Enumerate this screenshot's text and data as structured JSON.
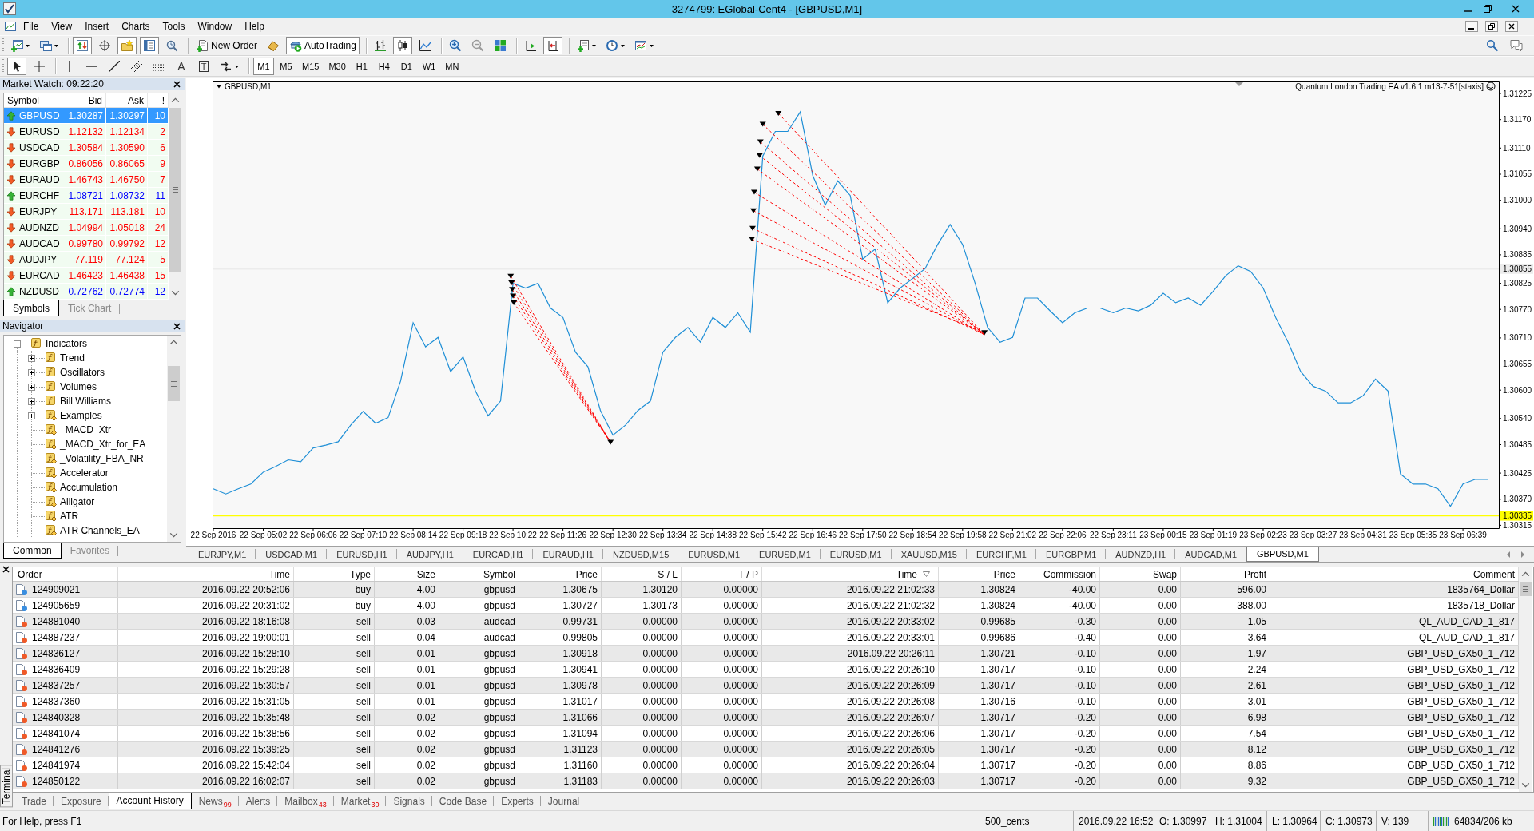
{
  "window": {
    "title": "3274799: EGlobal-Cent4 - [GBPUSD,M1]"
  },
  "menu": [
    "File",
    "View",
    "Insert",
    "Charts",
    "Tools",
    "Window",
    "Help"
  ],
  "toolbar": {
    "groups": [
      [
        {
          "pressed": false
        },
        {
          "pressed": false
        }
      ],
      [
        {
          "pressed": true
        },
        {
          "pressed": false
        },
        {
          "pressed": true
        },
        {
          "pressed": true
        },
        {
          "pressed": false
        }
      ],
      [
        {
          "label": "New Order",
          "pressed": false
        },
        {
          "pressed": false
        },
        {
          "label": "AutoTrading",
          "pressed": true
        }
      ],
      [
        {
          "pressed": false
        },
        {
          "pressed": true
        },
        {
          "pressed": false
        }
      ],
      [
        {
          "pressed": false
        },
        {
          "pressed": false
        },
        {
          "pressed": false
        }
      ],
      [
        {
          "pressed": false
        },
        {
          "pressed": true
        }
      ],
      [
        {
          "pressed": false
        },
        {
          "pressed": false
        },
        {
          "pressed": false
        }
      ]
    ]
  },
  "drawing_toolbar": {
    "groups": [
      [
        {
          "pressed": true
        },
        {
          "pressed": false
        }
      ],
      [
        {
          "pressed": false
        },
        {
          "pressed": false
        },
        {
          "pressed": false
        },
        {
          "pressed": false
        },
        {
          "pressed": false
        },
        {
          "glyph": "A",
          "pressed": false
        },
        {
          "glyph": "T",
          "pressed": false
        },
        {
          "pressed": false
        }
      ]
    ]
  },
  "timeframes": [
    {
      "label": "M1",
      "selected": true
    },
    {
      "label": "M5",
      "selected": false
    },
    {
      "label": "M15",
      "selected": false
    },
    {
      "label": "M30",
      "selected": false
    },
    {
      "label": "H1",
      "selected": false
    },
    {
      "label": "H4",
      "selected": false
    },
    {
      "label": "D1",
      "selected": false
    },
    {
      "label": "W1",
      "selected": false
    },
    {
      "label": "MN",
      "selected": false
    }
  ],
  "market_watch": {
    "title": "Market Watch: 09:22:20",
    "columns": [
      "Symbol",
      "Bid",
      "Ask",
      "!"
    ],
    "rows": [
      {
        "symbol": "GBPUSD",
        "bid": "1.30287",
        "ask": "1.30297",
        "spread": "10",
        "up": true,
        "selected": true
      },
      {
        "symbol": "EURUSD",
        "bid": "1.12132",
        "ask": "1.12134",
        "spread": "2",
        "up": false,
        "selected": false
      },
      {
        "symbol": "USDCAD",
        "bid": "1.30584",
        "ask": "1.30590",
        "spread": "6",
        "up": false,
        "selected": false
      },
      {
        "symbol": "EURGBP",
        "bid": "0.86056",
        "ask": "0.86065",
        "spread": "9",
        "up": false,
        "selected": false
      },
      {
        "symbol": "EURAUD",
        "bid": "1.46743",
        "ask": "1.46750",
        "spread": "7",
        "up": false,
        "selected": false
      },
      {
        "symbol": "EURCHF",
        "bid": "1.08721",
        "ask": "1.08732",
        "spread": "11",
        "up": true,
        "selected": false
      },
      {
        "symbol": "EURJPY",
        "bid": "113.171",
        "ask": "113.181",
        "spread": "10",
        "up": false,
        "selected": false
      },
      {
        "symbol": "AUDNZD",
        "bid": "1.04994",
        "ask": "1.05018",
        "spread": "24",
        "up": false,
        "selected": false
      },
      {
        "symbol": "AUDCAD",
        "bid": "0.99780",
        "ask": "0.99792",
        "spread": "12",
        "up": false,
        "selected": false
      },
      {
        "symbol": "AUDJPY",
        "bid": "77.119",
        "ask": "77.124",
        "spread": "5",
        "up": false,
        "selected": false
      },
      {
        "symbol": "EURCAD",
        "bid": "1.46423",
        "ask": "1.46438",
        "spread": "15",
        "up": false,
        "selected": false
      },
      {
        "symbol": "NZDUSD",
        "bid": "0.72762",
        "ask": "0.72774",
        "spread": "12",
        "up": true,
        "selected": false
      }
    ],
    "tabs": [
      {
        "label": "Symbols",
        "selected": true
      },
      {
        "label": "Tick Chart",
        "selected": false
      }
    ]
  },
  "navigator": {
    "title": "Navigator",
    "tree": [
      {
        "label": "Indicators",
        "kind": "folder",
        "custom": false,
        "expanded": true,
        "children": [
          {
            "label": "Trend",
            "kind": "folder",
            "custom": false,
            "expanded": false
          },
          {
            "label": "Oscillators",
            "kind": "folder",
            "custom": false,
            "expanded": false
          },
          {
            "label": "Volumes",
            "kind": "folder",
            "custom": false,
            "expanded": false
          },
          {
            "label": "Bill Williams",
            "kind": "folder",
            "custom": false,
            "expanded": false
          },
          {
            "label": "Examples",
            "kind": "folder",
            "custom": true,
            "expanded": false
          },
          {
            "label": "_MACD_Xtr",
            "kind": "item",
            "custom": true
          },
          {
            "label": "_MACD_Xtr_for_EA",
            "kind": "item",
            "custom": true
          },
          {
            "label": "_Volatility_FBA_NR",
            "kind": "item",
            "custom": true
          },
          {
            "label": "Accelerator",
            "kind": "item",
            "custom": true
          },
          {
            "label": "Accumulation",
            "kind": "item",
            "custom": true
          },
          {
            "label": "Alligator",
            "kind": "item",
            "custom": true
          },
          {
            "label": "ATR",
            "kind": "item",
            "custom": true
          },
          {
            "label": "ATR Channels_EA",
            "kind": "item",
            "custom": true
          }
        ]
      }
    ],
    "tabs": [
      {
        "label": "Common",
        "selected": true
      },
      {
        "label": "Favorites",
        "selected": false
      }
    ]
  },
  "chart": {
    "symbol": "GBPUSD,M1",
    "expert": "Quantum London Trading EA v1.6.1 m13-7-51[staxis]",
    "chart_data": {
      "type": "line",
      "xlim": [
        "2016-09-22T03:57",
        "2016-09-23T07:25"
      ],
      "ylim": [
        1.30309,
        1.31252
      ],
      "xticks": [
        {
          "value": "2016-09-22T03:58",
          "label": "22 Sep 2016"
        },
        {
          "value": "2016-09-22T05:02",
          "label": "22 Sep 05:02"
        },
        {
          "value": "2016-09-22T06:06",
          "label": "22 Sep 06:06"
        },
        {
          "value": "2016-09-22T07:10",
          "label": "22 Sep 07:10"
        },
        {
          "value": "2016-09-22T08:14",
          "label": "22 Sep 08:14"
        },
        {
          "value": "2016-09-22T09:18",
          "label": "22 Sep 09:18"
        },
        {
          "value": "2016-09-22T10:22",
          "label": "22 Sep 10:22"
        },
        {
          "value": "2016-09-22T11:26",
          "label": "22 Sep 11:26"
        },
        {
          "value": "2016-09-22T12:30",
          "label": "22 Sep 12:30"
        },
        {
          "value": "2016-09-22T13:34",
          "label": "22 Sep 13:34"
        },
        {
          "value": "2016-09-22T14:38",
          "label": "22 Sep 14:38"
        },
        {
          "value": "2016-09-22T15:42",
          "label": "22 Sep 15:42"
        },
        {
          "value": "2016-09-22T16:46",
          "label": "22 Sep 16:46"
        },
        {
          "value": "2016-09-22T17:50",
          "label": "22 Sep 17:50"
        },
        {
          "value": "2016-09-22T18:54",
          "label": "22 Sep 18:54"
        },
        {
          "value": "2016-09-22T19:58",
          "label": "22 Sep 19:58"
        },
        {
          "value": "2016-09-22T21:02",
          "label": "22 Sep 21:02"
        },
        {
          "value": "2016-09-22T22:06",
          "label": "22 Sep 22:06"
        },
        {
          "value": "2016-09-22T23:11",
          "label": "22 Sep 23:11"
        },
        {
          "value": "2016-09-23T00:15",
          "label": "23 Sep 00:15"
        },
        {
          "value": "2016-09-23T01:19",
          "label": "23 Sep 01:19"
        },
        {
          "value": "2016-09-23T02:23",
          "label": "23 Sep 02:23"
        },
        {
          "value": "2016-09-23T03:27",
          "label": "23 Sep 03:27"
        },
        {
          "value": "2016-09-23T04:31",
          "label": "23 Sep 04:31"
        },
        {
          "value": "2016-09-23T05:35",
          "label": "23 Sep 05:35"
        },
        {
          "value": "2016-09-23T06:39",
          "label": "23 Sep 06:39"
        }
      ],
      "yticks": [
        {
          "value": 1.31225,
          "label": "1.31225"
        },
        {
          "value": 1.3117,
          "label": "1.31170"
        },
        {
          "value": 1.3111,
          "label": "1.31110"
        },
        {
          "value": 1.31055,
          "label": "1.31055"
        },
        {
          "value": 1.31,
          "label": "1.31000"
        },
        {
          "value": 1.3094,
          "label": "1.30940"
        },
        {
          "value": 1.30885,
          "label": "1.30885"
        },
        {
          "value": 1.30825,
          "label": "1.30825"
        },
        {
          "value": 1.3077,
          "label": "1.30770"
        },
        {
          "value": 1.3071,
          "label": "1.30710"
        },
        {
          "value": 1.30655,
          "label": "1.30655"
        },
        {
          "value": 1.306,
          "label": "1.30600"
        },
        {
          "value": 1.3054,
          "label": "1.30540"
        },
        {
          "value": 1.30485,
          "label": "1.30485"
        },
        {
          "value": 1.30425,
          "label": "1.30425"
        },
        {
          "value": 1.3037,
          "label": "1.30370"
        },
        {
          "value": 1.30315,
          "label": "1.30315"
        }
      ],
      "ref_lines": [
        {
          "axis": "y",
          "value": 1.30855,
          "label": "1.30855",
          "color": "#ececec"
        },
        {
          "axis": "y",
          "value": 1.30335,
          "label": "1.30335",
          "color": "#ffff00"
        }
      ],
      "series": [
        {
          "color": "#1f8fd6",
          "x": [
            "2016-09-22T03:58",
            "2016-09-22T04:14",
            "2016-09-22T04:30",
            "2016-09-22T04:46",
            "2016-09-22T05:02",
            "2016-09-22T05:18",
            "2016-09-22T05:34",
            "2016-09-22T05:50",
            "2016-09-22T06:06",
            "2016-09-22T06:22",
            "2016-09-22T06:38",
            "2016-09-22T06:54",
            "2016-09-22T07:10",
            "2016-09-22T07:26",
            "2016-09-22T07:42",
            "2016-09-22T07:58",
            "2016-09-22T08:14",
            "2016-09-22T08:30",
            "2016-09-22T08:46",
            "2016-09-22T09:02",
            "2016-09-22T09:18",
            "2016-09-22T09:34",
            "2016-09-22T09:50",
            "2016-09-22T10:06",
            "2016-09-22T10:22",
            "2016-09-22T10:38",
            "2016-09-22T10:54",
            "2016-09-22T11:10",
            "2016-09-22T11:26",
            "2016-09-22T11:42",
            "2016-09-22T11:58",
            "2016-09-22T12:14",
            "2016-09-22T12:30",
            "2016-09-22T12:46",
            "2016-09-22T13:02",
            "2016-09-22T13:18",
            "2016-09-22T13:34",
            "2016-09-22T13:50",
            "2016-09-22T14:06",
            "2016-09-22T14:22",
            "2016-09-22T14:38",
            "2016-09-22T14:54",
            "2016-09-22T15:10",
            "2016-09-22T15:26",
            "2016-09-22T15:42",
            "2016-09-22T15:58",
            "2016-09-22T16:14",
            "2016-09-22T16:30",
            "2016-09-22T16:46",
            "2016-09-22T17:02",
            "2016-09-22T17:18",
            "2016-09-22T17:34",
            "2016-09-22T17:50",
            "2016-09-22T18:06",
            "2016-09-22T18:22",
            "2016-09-22T18:38",
            "2016-09-22T18:54",
            "2016-09-22T19:10",
            "2016-09-22T19:26",
            "2016-09-22T19:42",
            "2016-09-22T19:58",
            "2016-09-22T20:14",
            "2016-09-22T20:30",
            "2016-09-22T20:46",
            "2016-09-22T21:02",
            "2016-09-22T21:18",
            "2016-09-22T21:34",
            "2016-09-22T21:50",
            "2016-09-22T22:06",
            "2016-09-22T22:22",
            "2016-09-22T22:38",
            "2016-09-22T22:54",
            "2016-09-22T23:11",
            "2016-09-22T23:27",
            "2016-09-22T23:43",
            "2016-09-22T23:59",
            "2016-09-23T00:15",
            "2016-09-23T00:31",
            "2016-09-23T00:47",
            "2016-09-23T01:03",
            "2016-09-23T01:19",
            "2016-09-23T01:35",
            "2016-09-23T01:51",
            "2016-09-23T02:07",
            "2016-09-23T02:23",
            "2016-09-23T02:39",
            "2016-09-23T02:55",
            "2016-09-23T03:11",
            "2016-09-23T03:27",
            "2016-09-23T03:43",
            "2016-09-23T03:59",
            "2016-09-23T04:15",
            "2016-09-23T04:31",
            "2016-09-23T04:47",
            "2016-09-23T05:03",
            "2016-09-23T05:19",
            "2016-09-23T05:35",
            "2016-09-23T05:51",
            "2016-09-23T06:07",
            "2016-09-23T06:23",
            "2016-09-23T06:39",
            "2016-09-23T06:55",
            "2016-09-23T07:11"
          ],
          "values": [
            1.30392,
            1.30381,
            1.30392,
            1.30402,
            1.30427,
            1.30439,
            1.30453,
            1.30449,
            1.30478,
            1.30484,
            1.30491,
            1.30526,
            1.30555,
            1.3053,
            1.30542,
            1.30619,
            1.30742,
            1.30691,
            1.30711,
            1.30639,
            1.3067,
            1.30598,
            1.30546,
            1.30577,
            1.30825,
            1.30815,
            1.30825,
            1.30773,
            1.30753,
            1.3068,
            1.30649,
            1.30557,
            1.30505,
            1.30526,
            1.30557,
            1.30577,
            1.3068,
            1.30711,
            1.30732,
            1.30701,
            1.30753,
            1.30732,
            1.30763,
            1.30722,
            1.31093,
            1.31145,
            1.31145,
            1.31186,
            1.31052,
            1.3099,
            1.31041,
            1.3101,
            1.30876,
            1.30897,
            1.30784,
            1.30815,
            1.30835,
            1.30856,
            1.30907,
            1.30949,
            1.30907,
            1.30825,
            1.30732,
            1.30701,
            1.30711,
            1.30794,
            1.30794,
            1.30767,
            1.30742,
            1.30763,
            1.30773,
            1.30773,
            1.30763,
            1.30773,
            1.30767,
            1.30779,
            1.30804,
            1.30784,
            1.30794,
            1.30779,
            1.30808,
            1.30841,
            1.30862,
            1.3085,
            1.30815,
            1.30753,
            1.30701,
            1.30639,
            1.30608,
            1.30598,
            1.30573,
            1.30573,
            1.30588,
            1.30623,
            1.30598,
            1.30423,
            1.30402,
            1.30402,
            1.30392,
            1.30355,
            1.30402,
            1.30412,
            1.30412
          ]
        },
        {
          "type": "line",
          "color": "#ff0000",
          "line_style": "dashed",
          "marker": "triangle",
          "x": [
            "2016-09-22T10:19",
            "2016-09-22T12:27"
          ],
          "values": [
            1.3084,
            1.3049
          ]
        },
        {
          "type": "line",
          "color": "#ff0000",
          "line_style": "dashed",
          "marker": "triangle",
          "x": [
            "2016-09-22T10:20",
            "2016-09-22T12:27"
          ],
          "values": [
            1.30826,
            1.3049
          ]
        },
        {
          "type": "line",
          "color": "#ff0000",
          "line_style": "dashed",
          "marker": "triangle",
          "x": [
            "2016-09-22T10:21",
            "2016-09-22T12:27"
          ],
          "values": [
            1.30812,
            1.3049
          ]
        },
        {
          "type": "line",
          "color": "#ff0000",
          "line_style": "dashed",
          "marker": "triangle",
          "x": [
            "2016-09-22T10:22",
            "2016-09-22T12:27"
          ],
          "values": [
            1.30798,
            1.3049
          ]
        },
        {
          "type": "line",
          "color": "#ff0000",
          "line_style": "dashed",
          "marker": "triangle",
          "x": [
            "2016-09-22T10:23",
            "2016-09-22T12:27"
          ],
          "values": [
            1.30784,
            1.3049
          ]
        },
        {
          "type": "line",
          "color": "#ff0000",
          "line_style": "dashed",
          "marker": "triangle",
          "x": [
            "2016-09-22T15:28",
            "2016-09-22T20:26"
          ],
          "values": [
            1.30918,
            1.30721
          ]
        },
        {
          "type": "line",
          "color": "#ff0000",
          "line_style": "dashed",
          "marker": "triangle",
          "x": [
            "2016-09-22T15:29",
            "2016-09-22T20:26"
          ],
          "values": [
            1.30941,
            1.30717
          ]
        },
        {
          "type": "line",
          "color": "#ff0000",
          "line_style": "dashed",
          "marker": "triangle",
          "x": [
            "2016-09-22T15:30",
            "2016-09-22T20:26"
          ],
          "values": [
            1.30978,
            1.30717
          ]
        },
        {
          "type": "line",
          "color": "#ff0000",
          "line_style": "dashed",
          "marker": "triangle",
          "x": [
            "2016-09-22T15:31",
            "2016-09-22T20:26"
          ],
          "values": [
            1.31017,
            1.30716
          ]
        },
        {
          "type": "line",
          "color": "#ff0000",
          "line_style": "dashed",
          "marker": "triangle",
          "x": [
            "2016-09-22T15:35",
            "2016-09-22T20:26"
          ],
          "values": [
            1.31066,
            1.30717
          ]
        },
        {
          "type": "line",
          "color": "#ff0000",
          "line_style": "dashed",
          "marker": "triangle",
          "x": [
            "2016-09-22T15:38",
            "2016-09-22T20:26"
          ],
          "values": [
            1.31094,
            1.30717
          ]
        },
        {
          "type": "line",
          "color": "#ff0000",
          "line_style": "dashed",
          "marker": "triangle",
          "x": [
            "2016-09-22T15:39",
            "2016-09-22T20:26"
          ],
          "values": [
            1.31123,
            1.30717
          ]
        },
        {
          "type": "line",
          "color": "#ff0000",
          "line_style": "dashed",
          "marker": "triangle",
          "x": [
            "2016-09-22T15:42",
            "2016-09-22T20:26"
          ],
          "values": [
            1.3116,
            1.30717
          ]
        },
        {
          "type": "line",
          "color": "#ff0000",
          "line_style": "dashed",
          "marker": "triangle",
          "x": [
            "2016-09-22T16:02",
            "2016-09-22T20:26"
          ],
          "values": [
            1.31183,
            1.30717
          ]
        }
      ]
    },
    "tabs": [
      {
        "label": "EURJPY,M1",
        "selected": false
      },
      {
        "label": "USDCAD,M1",
        "selected": false
      },
      {
        "label": "EURUSD,H1",
        "selected": false
      },
      {
        "label": "AUDJPY,H1",
        "selected": false
      },
      {
        "label": "EURCAD,H1",
        "selected": false
      },
      {
        "label": "EURAUD,H1",
        "selected": false
      },
      {
        "label": "NZDUSD,M15",
        "selected": false
      },
      {
        "label": "EURUSD,M1",
        "selected": false
      },
      {
        "label": "EURUSD,M1",
        "selected": false
      },
      {
        "label": "EURUSD,M1",
        "selected": false
      },
      {
        "label": "XAUUSD,M15",
        "selected": false
      },
      {
        "label": "EURCHF,M1",
        "selected": false
      },
      {
        "label": "EURGBP,M1",
        "selected": false
      },
      {
        "label": "AUDNZD,H1",
        "selected": false
      },
      {
        "label": "AUDCAD,M1",
        "selected": false
      },
      {
        "label": "GBPUSD,M1",
        "selected": true
      }
    ]
  },
  "terminal": {
    "title": "Terminal",
    "columns": [
      {
        "label": "Order",
        "sorted": false
      },
      {
        "label": "Time",
        "sorted": false
      },
      {
        "label": "Type",
        "sorted": false
      },
      {
        "label": "Size",
        "sorted": false
      },
      {
        "label": "Symbol",
        "sorted": false
      },
      {
        "label": "Price",
        "sorted": false
      },
      {
        "label": "S / L",
        "sorted": false
      },
      {
        "label": "T / P",
        "sorted": false
      },
      {
        "label": "Time",
        "sorted": true
      },
      {
        "label": "Price",
        "sorted": false
      },
      {
        "label": "Commission",
        "sorted": false
      },
      {
        "label": "Swap",
        "sorted": false
      },
      {
        "label": "Profit",
        "sorted": false
      },
      {
        "label": "Comment",
        "sorted": false
      }
    ],
    "rows": [
      {
        "color": "#3a8ee0",
        "cells": [
          "124909021",
          "2016.09.22 20:52:06",
          "buy",
          "4.00",
          "gbpusd",
          "1.30675",
          "1.30120",
          "0.00000",
          "2016.09.22 21:02:33",
          "1.30824",
          "-40.00",
          "0.00",
          "596.00",
          "1835764_Dollar"
        ]
      },
      {
        "color": "#3a8ee0",
        "cells": [
          "124905659",
          "2016.09.22 20:31:02",
          "buy",
          "4.00",
          "gbpusd",
          "1.30727",
          "1.30173",
          "0.00000",
          "2016.09.22 21:02:32",
          "1.30824",
          "-40.00",
          "0.00",
          "388.00",
          "1835718_Dollar"
        ]
      },
      {
        "color": "#f05a28",
        "cells": [
          "124881040",
          "2016.09.22 18:16:08",
          "sell",
          "0.03",
          "audcad",
          "0.99731",
          "0.00000",
          "0.00000",
          "2016.09.22 20:33:02",
          "0.99685",
          "-0.30",
          "0.00",
          "1.05",
          "QL_AUD_CAD_1_817"
        ]
      },
      {
        "color": "#f05a28",
        "cells": [
          "124887237",
          "2016.09.22 19:00:01",
          "sell",
          "0.04",
          "audcad",
          "0.99805",
          "0.00000",
          "0.00000",
          "2016.09.22 20:33:01",
          "0.99686",
          "-0.40",
          "0.00",
          "3.64",
          "QL_AUD_CAD_1_817"
        ]
      },
      {
        "color": "#f05a28",
        "cells": [
          "124836127",
          "2016.09.22 15:28:10",
          "sell",
          "0.01",
          "gbpusd",
          "1.30918",
          "0.00000",
          "0.00000",
          "2016.09.22 20:26:11",
          "1.30721",
          "-0.10",
          "0.00",
          "1.97",
          "GBP_USD_GX50_1_712"
        ]
      },
      {
        "color": "#f05a28",
        "cells": [
          "124836409",
          "2016.09.22 15:29:28",
          "sell",
          "0.01",
          "gbpusd",
          "1.30941",
          "0.00000",
          "0.00000",
          "2016.09.22 20:26:10",
          "1.30717",
          "-0.10",
          "0.00",
          "2.24",
          "GBP_USD_GX50_1_712"
        ]
      },
      {
        "color": "#f05a28",
        "cells": [
          "124837257",
          "2016.09.22 15:30:57",
          "sell",
          "0.01",
          "gbpusd",
          "1.30978",
          "0.00000",
          "0.00000",
          "2016.09.22 20:26:09",
          "1.30717",
          "-0.10",
          "0.00",
          "2.61",
          "GBP_USD_GX50_1_712"
        ]
      },
      {
        "color": "#f05a28",
        "cells": [
          "124837360",
          "2016.09.22 15:31:05",
          "sell",
          "0.01",
          "gbpusd",
          "1.31017",
          "0.00000",
          "0.00000",
          "2016.09.22 20:26:08",
          "1.30716",
          "-0.10",
          "0.00",
          "3.01",
          "GBP_USD_GX50_1_712"
        ]
      },
      {
        "color": "#f05a28",
        "cells": [
          "124840328",
          "2016.09.22 15:35:48",
          "sell",
          "0.02",
          "gbpusd",
          "1.31066",
          "0.00000",
          "0.00000",
          "2016.09.22 20:26:07",
          "1.30717",
          "-0.20",
          "0.00",
          "6.98",
          "GBP_USD_GX50_1_712"
        ]
      },
      {
        "color": "#f05a28",
        "cells": [
          "124841074",
          "2016.09.22 15:38:56",
          "sell",
          "0.02",
          "gbpusd",
          "1.31094",
          "0.00000",
          "0.00000",
          "2016.09.22 20:26:06",
          "1.30717",
          "-0.20",
          "0.00",
          "7.54",
          "GBP_USD_GX50_1_712"
        ]
      },
      {
        "color": "#f05a28",
        "cells": [
          "124841276",
          "2016.09.22 15:39:25",
          "sell",
          "0.02",
          "gbpusd",
          "1.31123",
          "0.00000",
          "0.00000",
          "2016.09.22 20:26:05",
          "1.30717",
          "-0.20",
          "0.00",
          "8.12",
          "GBP_USD_GX50_1_712"
        ]
      },
      {
        "color": "#f05a28",
        "cells": [
          "124841974",
          "2016.09.22 15:42:04",
          "sell",
          "0.02",
          "gbpusd",
          "1.31160",
          "0.00000",
          "0.00000",
          "2016.09.22 20:26:04",
          "1.30717",
          "-0.20",
          "0.00",
          "8.86",
          "GBP_USD_GX50_1_712"
        ]
      },
      {
        "color": "#f05a28",
        "cells": [
          "124850122",
          "2016.09.22 16:02:07",
          "sell",
          "0.02",
          "gbpusd",
          "1.31183",
          "0.00000",
          "0.00000",
          "2016.09.22 20:26:03",
          "1.30717",
          "-0.20",
          "0.00",
          "9.32",
          "GBP_USD_GX50_1_712"
        ]
      }
    ],
    "tabs": [
      {
        "label": "Trade",
        "selected": false
      },
      {
        "label": "Exposure",
        "selected": false
      },
      {
        "label": "Account History",
        "selected": true
      },
      {
        "label": "News",
        "badge": "99",
        "selected": false
      },
      {
        "label": "Alerts",
        "selected": false
      },
      {
        "label": "Mailbox",
        "badge": "43",
        "selected": false
      },
      {
        "label": "Market",
        "badge": "30",
        "selected": false
      },
      {
        "label": "Signals",
        "selected": false
      },
      {
        "label": "Code Base",
        "selected": false
      },
      {
        "label": "Experts",
        "selected": false
      },
      {
        "label": "Journal",
        "selected": false
      }
    ]
  },
  "status_bar": {
    "help": "For Help, press F1",
    "fields": [
      "500_cents",
      "2016.09.22 16:52",
      "O: 1.30997",
      "H: 1.31004",
      "L: 1.30964",
      "C: 1.30973",
      "V: 139"
    ],
    "traffic": "64834/206 kb"
  }
}
